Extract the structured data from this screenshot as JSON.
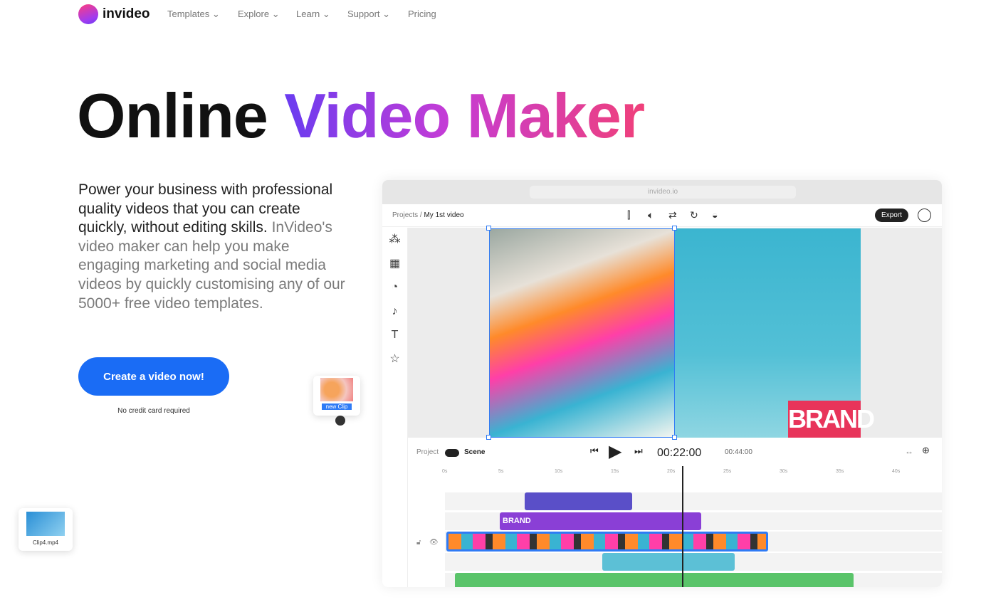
{
  "nav": {
    "logo": "invideo",
    "items": [
      {
        "label": "Templates",
        "dropdown": true
      },
      {
        "label": "Explore",
        "dropdown": true
      },
      {
        "label": "Learn",
        "dropdown": true
      },
      {
        "label": "Support",
        "dropdown": true
      },
      {
        "label": "Pricing",
        "dropdown": false
      }
    ]
  },
  "hero": {
    "title_plain": "Online ",
    "title_gradient": "Video Maker",
    "desc_dark": "Power your business with professional quality videos that you can create quickly, without editing skills.",
    "desc_light": " InVideo's video maker can help you make engaging marketing and social media videos by quickly customising any of our 5000+ free video templates.",
    "cta": "Create a video now!",
    "note": "No credit card required"
  },
  "editor": {
    "url": "invideo.io",
    "breadcrumb_root": "Projects",
    "breadcrumb_current": "My 1st video",
    "export": "Export",
    "brand_text": "BRAND",
    "toggle_left": "Project",
    "toggle_right": "Scene",
    "current_time": "00:22:00",
    "total_time": "00:44:00",
    "ruler": [
      "0s",
      "5s",
      "10s",
      "15s",
      "20s",
      "25s",
      "30s",
      "35s",
      "40s"
    ],
    "track_brand": "BRAND"
  },
  "floating": {
    "new_clip": "new Clip",
    "clip4": "Clip4.mp4"
  },
  "colors": {
    "cta": "#1a6cf5",
    "grad_start": "#6a3cf0",
    "grad_end": "#f0407a"
  }
}
